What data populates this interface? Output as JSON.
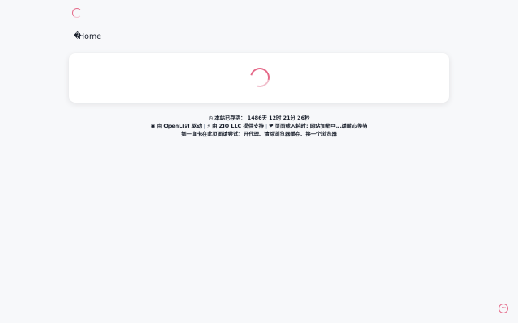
{
  "nav": {
    "home_label": "Home"
  },
  "footer": {
    "uptime": "本站已存活： 1486天 12时 21分 26秒",
    "powered_by": "由 OpenList 驱动",
    "supported_by": "由 ZIO LLC 提供支持",
    "load_time": "页面载入耗时: 网站加载中...请耐心等待",
    "hint": "如一直卡在此页面请尝试：开代理、清除浏览器缓存、换一个浏览器"
  },
  "icons": {
    "clock": "clock-icon",
    "github": "github-icon",
    "bolt": "bolt-icon",
    "heart": "heart-icon",
    "more": "more-icon"
  },
  "colors": {
    "accent": "#e56b8a",
    "background": "#f7f8fa",
    "card": "#ffffff"
  }
}
